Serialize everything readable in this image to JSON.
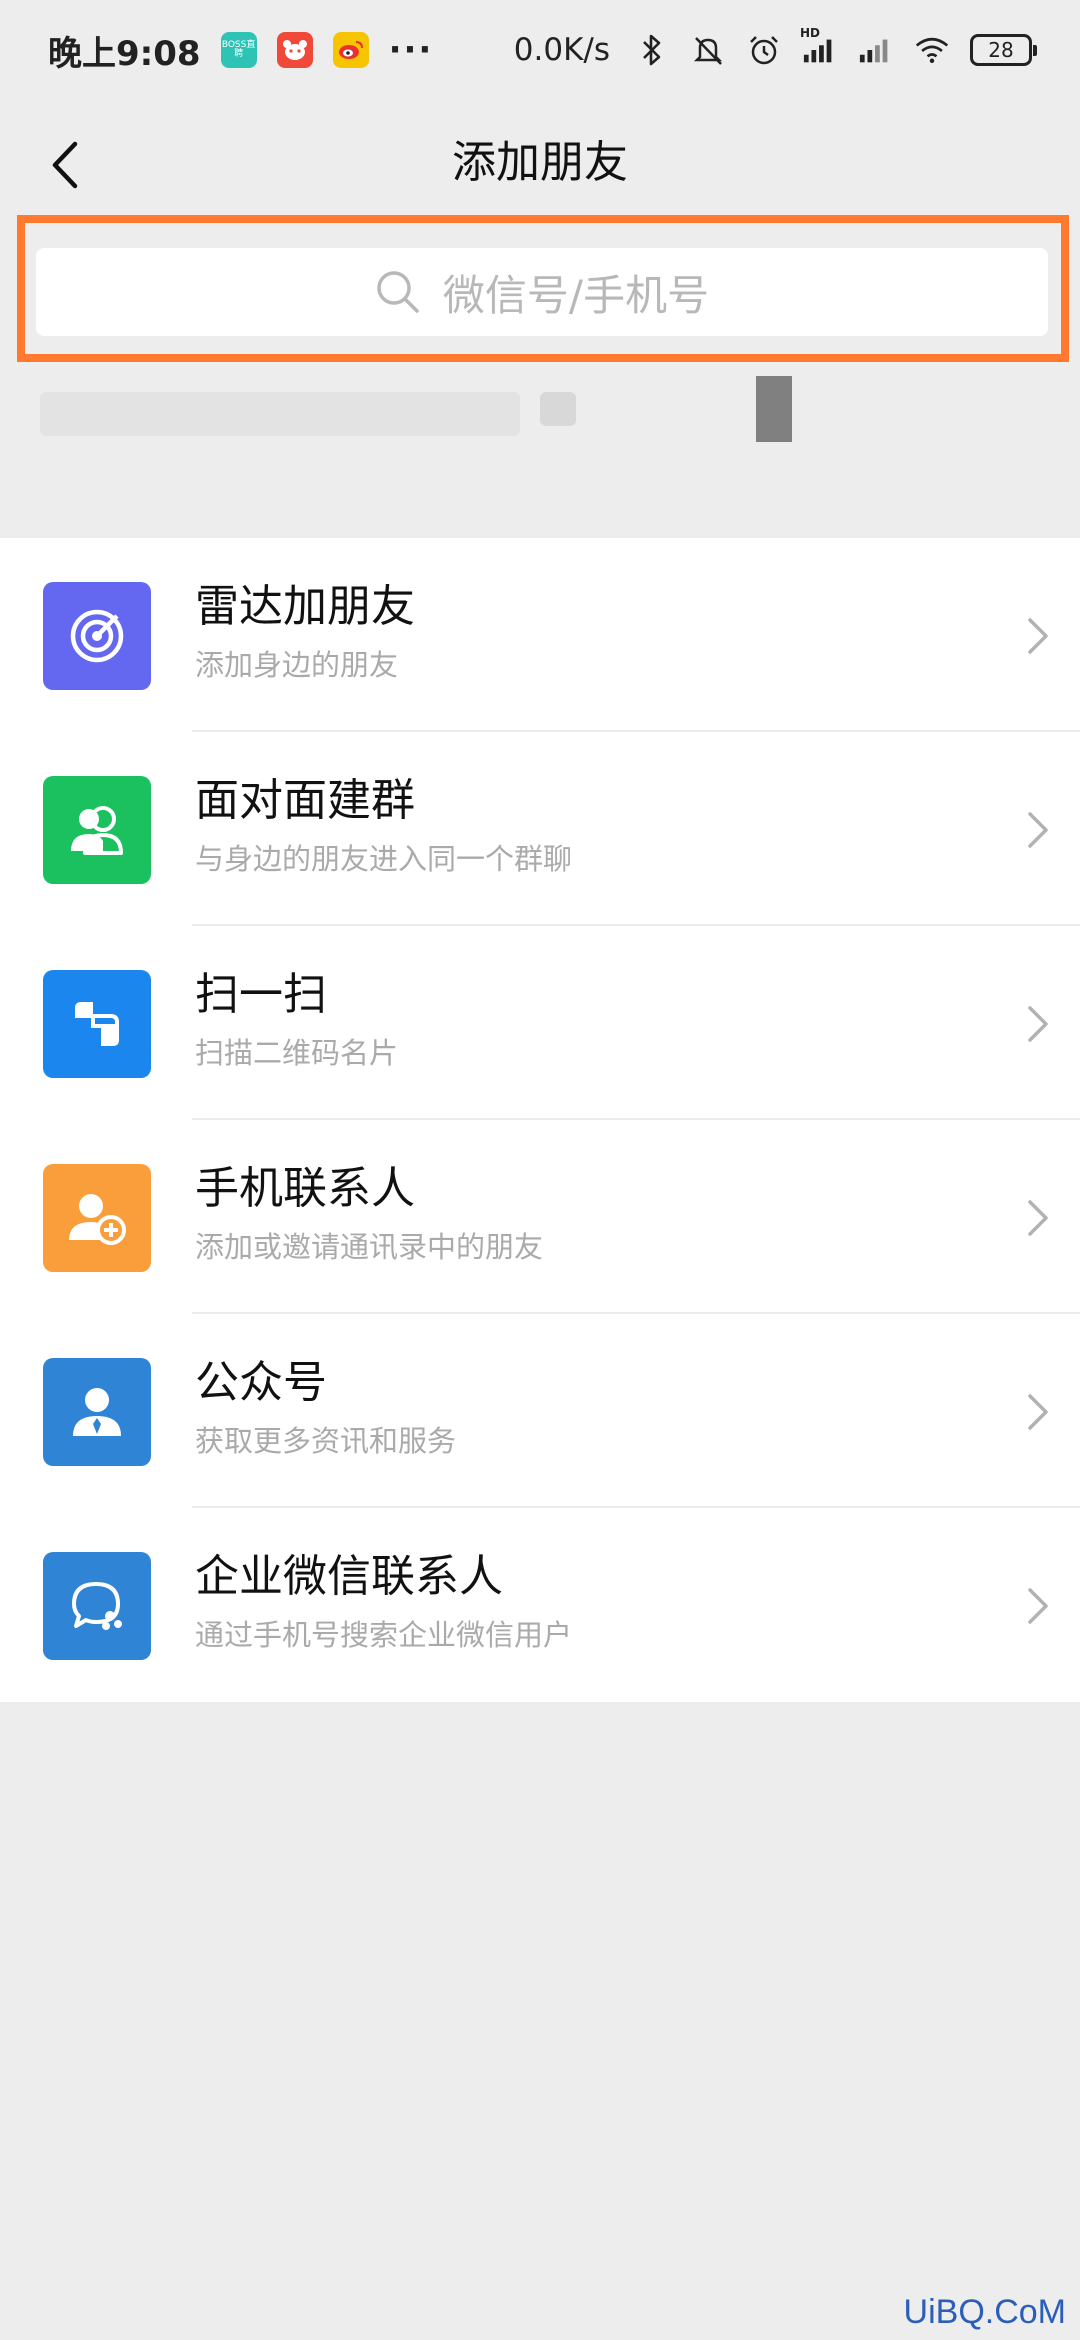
{
  "status_bar": {
    "time": "晚上9:08",
    "boss_icon_text": "BOSS直聘",
    "more": "···",
    "net_speed": "0.0K/s",
    "signal_badge": "HD",
    "battery": "28"
  },
  "header": {
    "title": "添加朋友",
    "back_icon": "back-chevron-icon"
  },
  "search": {
    "placeholder": "微信号/手机号",
    "highlight_color": "#ff7a2e"
  },
  "menu": [
    {
      "title": "雷达加朋友",
      "subtitle": "添加身边的朋友",
      "icon": "radar-icon",
      "color": "#6467ef"
    },
    {
      "title": "面对面建群",
      "subtitle": "与身边的朋友进入同一个群聊",
      "icon": "group-icon",
      "color": "#1bc15f"
    },
    {
      "title": "扫一扫",
      "subtitle": "扫描二维码名片",
      "icon": "scan-icon",
      "color": "#1b86ee"
    },
    {
      "title": "手机联系人",
      "subtitle": "添加或邀请通讯录中的朋友",
      "icon": "contact-add-icon",
      "color": "#fa9d3b"
    },
    {
      "title": "公众号",
      "subtitle": "获取更多资讯和服务",
      "icon": "official-account-icon",
      "color": "#2f84d6"
    },
    {
      "title": "企业微信联系人",
      "subtitle": "通过手机号搜索企业微信用户",
      "icon": "work-chat-icon",
      "color": "#2f84d6"
    }
  ],
  "watermark": "UiBQ.CoM"
}
